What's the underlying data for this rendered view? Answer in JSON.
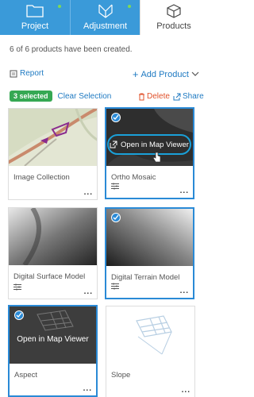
{
  "tabs": [
    {
      "label": "Project"
    },
    {
      "label": "Adjustment"
    },
    {
      "label": "Products"
    }
  ],
  "status_message": "6 of 6 products have been created.",
  "toolbar": {
    "report_label": "Report",
    "add_product_label": "Add Product"
  },
  "selection": {
    "count_label": "3 selected",
    "clear_label": "Clear Selection",
    "delete_label": "Delete",
    "share_label": "Share"
  },
  "cards": [
    {
      "label": "Image Collection",
      "menu": "..."
    },
    {
      "label": "Ortho Mosaic",
      "menu": "...",
      "overlay": "Open in Map Viewer"
    },
    {
      "label": "Digital Surface Model",
      "menu": "..."
    },
    {
      "label": "Digital Terrain Model",
      "menu": "..."
    },
    {
      "label": "Aspect",
      "menu": "...",
      "overlay": "Open in Map Viewer"
    },
    {
      "label": "Slope",
      "menu": "..."
    }
  ],
  "colors": {
    "tab_active_bg": "#3a9ad9",
    "link": "#1f7ac2",
    "selected_badge": "#35a853",
    "selected_border": "#2a8ad6",
    "delete": "#e0512a"
  }
}
